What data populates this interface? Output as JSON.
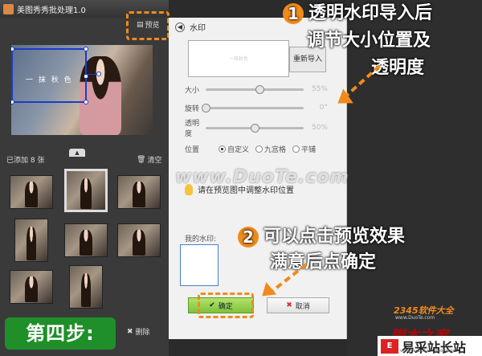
{
  "window": {
    "title": "美图秀秀批处理1.0"
  },
  "toolbar": {
    "preview_label": "预览"
  },
  "photo": {
    "watermark_text": "一 抹 秋 色"
  },
  "list": {
    "added_label": "已添加 8 张",
    "clear_label": "清空",
    "delete_label": "删除"
  },
  "dialog": {
    "title": "水印",
    "preview_text": "一抹秋色",
    "reimport_label": "重新导入",
    "sliders": [
      {
        "label": "大小",
        "value": "55%",
        "level": 0.55
      },
      {
        "label": "旋转",
        "value": "0°",
        "level": 0.0
      },
      {
        "label": "透明度",
        "value": "50%",
        "level": 0.5
      }
    ],
    "position_label": "位置",
    "position_options": [
      "自定义",
      "九宫格",
      "平铺"
    ],
    "position_selected": "自定义",
    "tip": "请在预览图中调整水印位置",
    "my_watermark_label": "我的水印:",
    "ok_label": "确定",
    "cancel_label": "取消"
  },
  "annotations": {
    "step1_number": "1",
    "step1_line1": "透明水印导入后",
    "step1_line2": "调节大小位置及",
    "step1_line3": "透明度",
    "step2_number": "2",
    "step2_line1": "可以点击预览效果",
    "step2_line2": "满意后点确定",
    "step_label": "第四步:"
  },
  "watermarks": {
    "site": "www.DuoTe.com",
    "brand1": "2345软件大全",
    "brand1_sub": "www.DuoTe.com",
    "brand2": "脚本之家",
    "brand3": "易采站长站",
    "brand3_url": "www.Easck.Com Webmaster"
  },
  "colors": {
    "accent": "#f08a1c",
    "step_green": "#1f8f2a",
    "handle_blue": "#1c3cc7"
  }
}
